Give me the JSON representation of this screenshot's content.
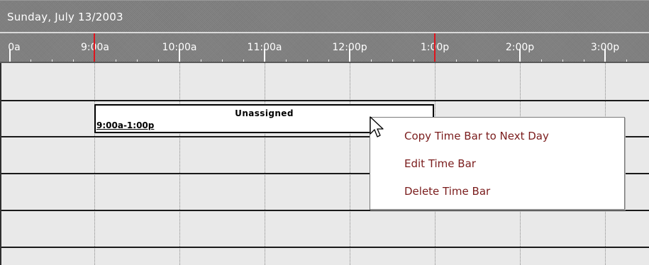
{
  "header": {
    "date": "Sunday, July 13/2003"
  },
  "ruler": {
    "labels": [
      "0a",
      "9:00a",
      "10:00a",
      "11:00a",
      "12:00p",
      "1:00p",
      "2:00p",
      "3:00p"
    ],
    "highlight_color": "#e0141c"
  },
  "time_bar": {
    "title": "Unassigned",
    "range": "9:00a-1:00p"
  },
  "context_menu": {
    "items": [
      "Copy Time Bar to Next Day",
      "Edit Time Bar",
      "Delete Time Bar"
    ],
    "text_color": "#7a1c1c"
  },
  "cursor": {
    "icon": "arrow-pointer-icon"
  }
}
